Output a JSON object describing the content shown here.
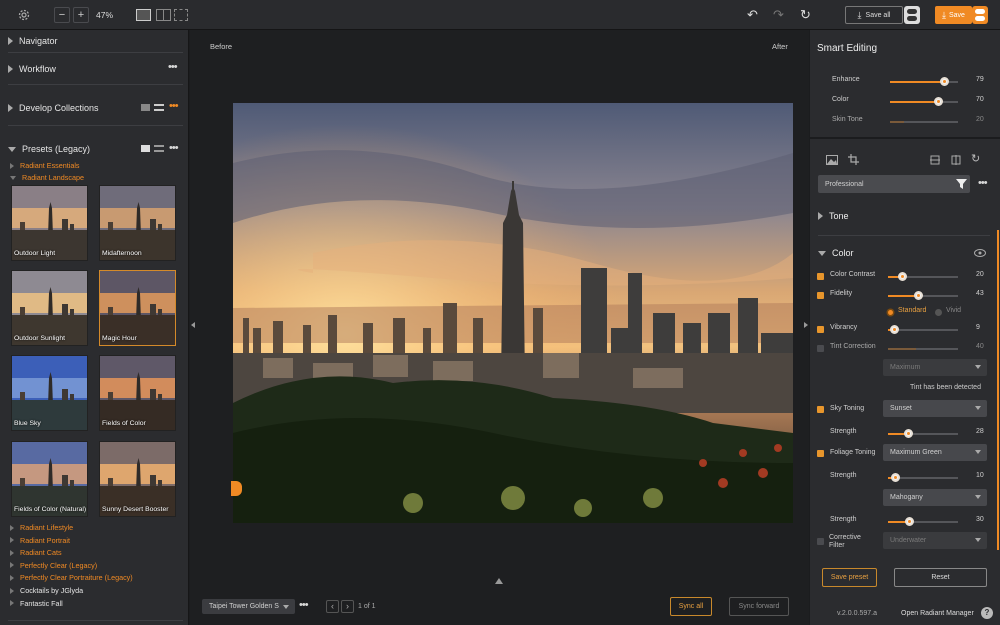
{
  "toolbar": {
    "zoom": "47%",
    "save_all_label": "Save all",
    "save_label": "Save"
  },
  "left": {
    "navigator": "Navigator",
    "workflow": "Workflow",
    "develop_collections": "Develop Collections",
    "presets_title": "Presets (Legacy)",
    "categories_top": [
      "Radiant Essentials",
      "Radiant Landscape"
    ],
    "thumbs": [
      "Outdoor Light",
      "Midafternoon",
      "Outdoor Sunlight",
      "Magic Hour",
      "Blue Sky",
      "Fields of Color",
      "Fields of Color (Natural)",
      "Sunny Desert Booster"
    ],
    "categories_bottom": [
      "Radiant Lifestyle",
      "Radiant Portrait",
      "Radiant Cats",
      "Perfectly Clear (Legacy)",
      "Perfectly Clear Portraiture (Legacy)",
      "Cocktails by JGlyda",
      "Fantastic Fall"
    ]
  },
  "center": {
    "before": "Before",
    "after": "After",
    "filename": "Taipei Tower Golden S",
    "page_info": "1 of 1",
    "sync_all": "Sync all",
    "sync_forward": "Sync forward"
  },
  "right": {
    "title": "Smart Editing",
    "enhance": {
      "label": "Enhance",
      "value": "79",
      "level": 79
    },
    "color": {
      "label": "Color",
      "value": "70",
      "level": 70
    },
    "skin_tone": {
      "label": "Skin Tone",
      "value": "20",
      "level": 20
    },
    "profile": "Professional",
    "tone": "Tone",
    "color_section": "Color",
    "color_contrast": {
      "label": "Color Contrast",
      "value": "20",
      "level": 20
    },
    "fidelity": {
      "label": "Fidelity",
      "value": "43",
      "level": 43
    },
    "standard": "Standard",
    "vivid": "Vivid",
    "vibrancy": {
      "label": "Vibrancy",
      "value": "9",
      "level": 9
    },
    "tint_correction": {
      "label": "Tint Correction",
      "value": "40",
      "level": 40
    },
    "tint_dropdown": "Maximum",
    "tint_detected": "Tint has been detected",
    "sky_toning": {
      "label": "Sky Toning",
      "option": "Sunset"
    },
    "sky_strength": {
      "label": "Strength",
      "value": "28",
      "level": 28
    },
    "foliage_toning": {
      "label": "Foliage Toning",
      "option": "Maximum Green"
    },
    "foliage_strength": {
      "label": "Strength",
      "value": "10",
      "level": 10
    },
    "mahogany": "Mahogany",
    "mahogany_strength": {
      "label": "Strength",
      "value": "30",
      "level": 30
    },
    "corrective_filter": {
      "label1": "Corrective",
      "label2": "Filter",
      "option": "Underwater"
    },
    "save_preset": "Save preset",
    "reset": "Reset",
    "version": "v.2.0.0.597.a",
    "open_manager": "Open Radiant Manager"
  },
  "colors": {
    "accent": "#f08a24"
  }
}
